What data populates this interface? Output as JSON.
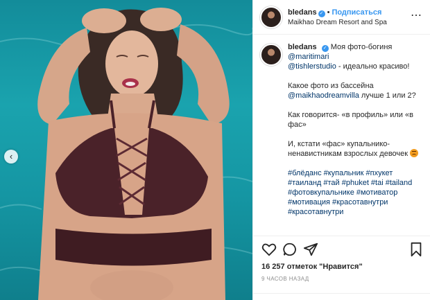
{
  "post": {
    "username": "bledans",
    "follow_label": "Подписаться",
    "location": "Maikhao Dream Resort and Spa",
    "separator": "•"
  },
  "caption": {
    "line1": "Моя фото-богиня",
    "mention1": "@maritimari",
    "mention2": "@tishlerstudio",
    "after_mention2": " - идеально красиво!",
    "p2_start": "Какое фото из бассейна ",
    "mention3": "@maikhaodreamvilla",
    "p2_end": " лучше 1 или 2?",
    "p3": "Как говорится- «в профиль» или «в фас»",
    "p4": "И, кстати «фас» купальнико-ненавистникам взрослых девочек",
    "hashtags": "#блёданс #купальник #пхукет #таиланд #тай #phuket #tai #tailand #фотовкупальнике #мотиватор #мотивация #красотавнутри #красотавнутри"
  },
  "actions": {
    "likes": "16 257 отметок \"Нравится\"",
    "time": "9 ЧАСОВ НАЗАД"
  },
  "icons": {
    "heart": "heart-icon",
    "comment": "comment-icon",
    "share": "share-icon",
    "bookmark": "bookmark-icon",
    "more": "more-icon",
    "prev": "chevron-left-icon"
  },
  "colors": {
    "accent": "#3897f0",
    "link": "#003569",
    "water": "#1aa3ae"
  }
}
